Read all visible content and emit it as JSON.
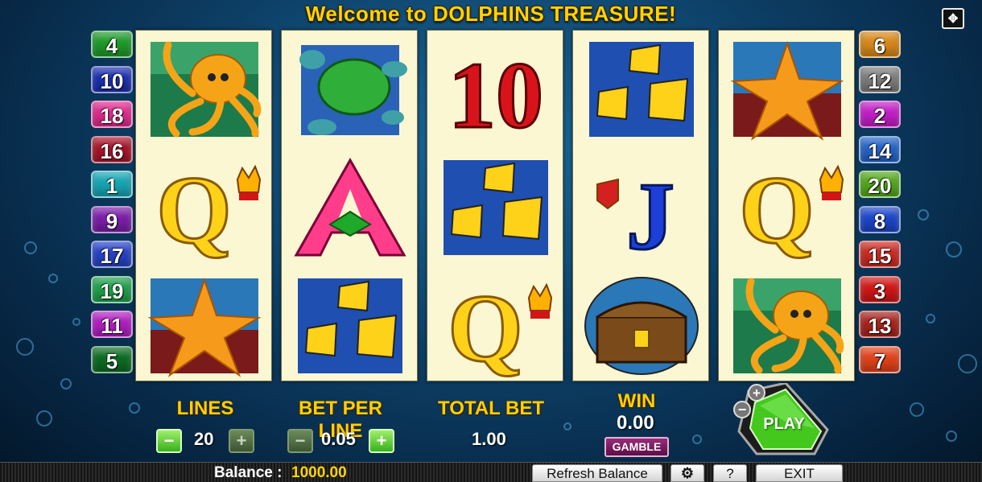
{
  "title": "Welcome to DOLPHINS TREASURE!",
  "fullscreen_icon": "fullscreen-arrows-icon",
  "paylines_left": [
    {
      "n": "4",
      "color": "#1f9a2a"
    },
    {
      "n": "10",
      "color": "#1b2fb0"
    },
    {
      "n": "18",
      "color": "#e02a8e"
    },
    {
      "n": "16",
      "color": "#a8142a"
    },
    {
      "n": "1",
      "color": "#17a5b3"
    },
    {
      "n": "9",
      "color": "#7a1ea8"
    },
    {
      "n": "17",
      "color": "#2742c8"
    },
    {
      "n": "19",
      "color": "#1ea04a"
    },
    {
      "n": "11",
      "color": "#b01ec0"
    },
    {
      "n": "5",
      "color": "#0d6b24"
    }
  ],
  "paylines_right": [
    {
      "n": "6",
      "color": "#d8881a"
    },
    {
      "n": "12",
      "color": "#7c7c7c"
    },
    {
      "n": "2",
      "color": "#c31ec6"
    },
    {
      "n": "14",
      "color": "#2363c8"
    },
    {
      "n": "20",
      "color": "#52a81a"
    },
    {
      "n": "8",
      "color": "#1c46c8"
    },
    {
      "n": "15",
      "color": "#cc2a22"
    },
    {
      "n": "3",
      "color": "#d01616"
    },
    {
      "n": "13",
      "color": "#a8231c"
    },
    {
      "n": "7",
      "color": "#e0421a"
    }
  ],
  "reels": [
    [
      "octopus",
      "queen",
      "starfish"
    ],
    [
      "turtle",
      "ace",
      "fish"
    ],
    [
      "ten",
      "fish",
      "queen"
    ],
    [
      "fish",
      "jack",
      "treasure-chest"
    ],
    [
      "starfish",
      "queen",
      "octopus"
    ]
  ],
  "controls": {
    "lines_label": "LINES",
    "lines_value": "20",
    "bet_label": "BET PER LINE",
    "bet_value": "0.05",
    "total_label": "TOTAL BET",
    "total_value": "1.00",
    "win_label": "WIN",
    "win_value": "0.00",
    "gamble_label": "GAMBLE",
    "play_label": "PLAY",
    "minus": "−",
    "plus": "+"
  },
  "bottom": {
    "balance_label": "Balance :",
    "balance_value": "1000.00",
    "refresh_label": "Refresh Balance",
    "settings_icon": "gear-icon",
    "help_label": "?",
    "exit_label": "EXIT"
  },
  "colors": {
    "title": "#ffd400",
    "reel_bg": "#fbf7d2",
    "play_green": "#45c81e",
    "balance": "#ffd400"
  }
}
